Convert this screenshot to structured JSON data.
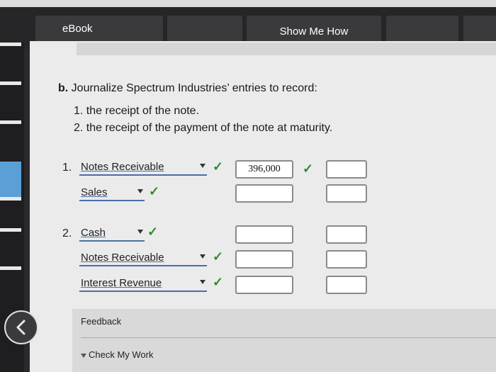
{
  "toolbar": {
    "ebook_label": "eBook",
    "show_me_how_label": "Show Me How"
  },
  "question": {
    "part": "b.",
    "title": "Journalize Spectrum Industries’ entries to record:",
    "items": [
      "1. the receipt of the note.",
      "2. the receipt of the payment of the note at maturity."
    ]
  },
  "entries": {
    "entry1": {
      "number": "1.",
      "debit_account": "Notes Receivable",
      "credit_account": "Sales",
      "debit_amount": "396,000",
      "credit_amount_1": "",
      "credit_amount_2": ""
    },
    "entry2": {
      "number": "2.",
      "debit_account": "Cash",
      "credit_account_1": "Notes Receivable",
      "credit_account_2": "Interest Revenue"
    }
  },
  "feedback": {
    "label": "Feedback",
    "check_my_work": "Check My Work"
  },
  "colors": {
    "check": "#2e8b2e",
    "select_underline": "#4a6fa5"
  }
}
